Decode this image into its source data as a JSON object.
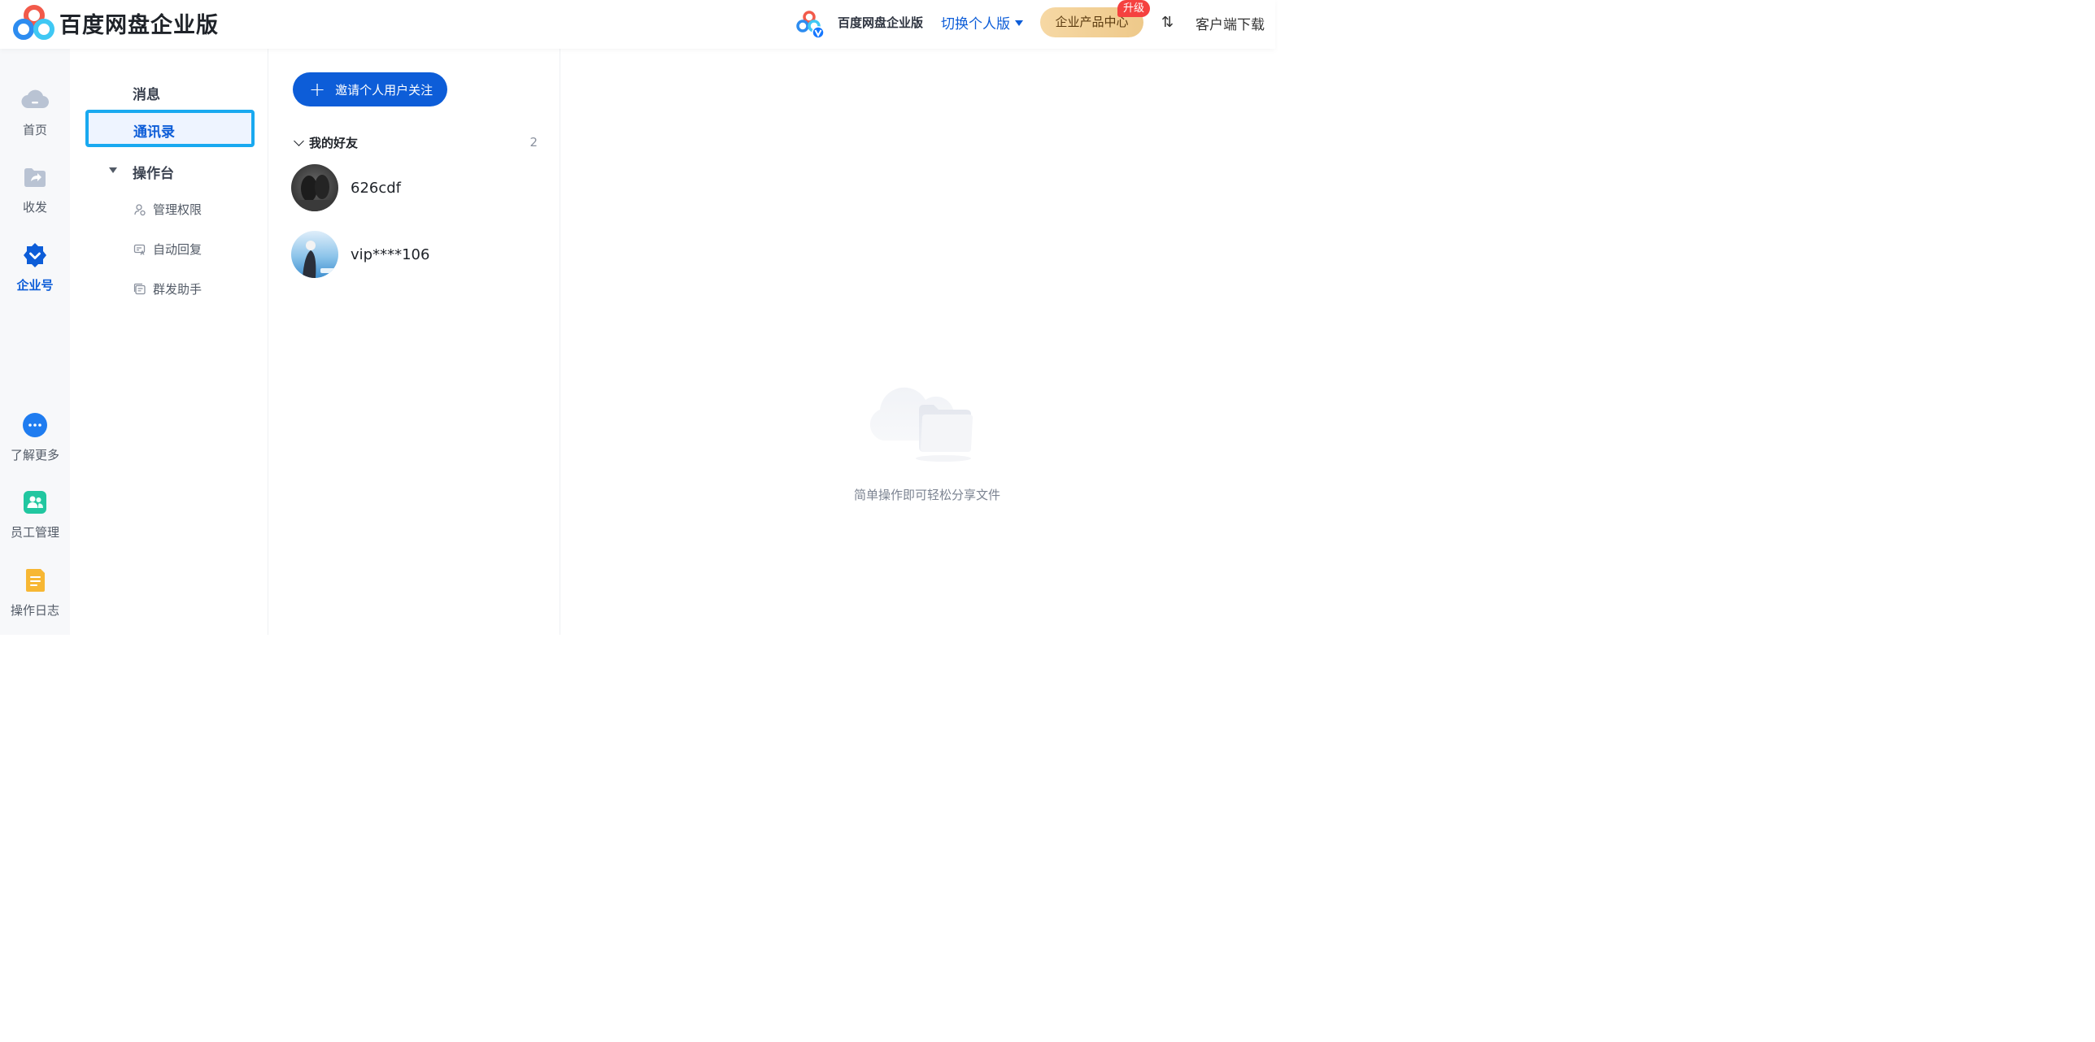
{
  "header": {
    "brand_title": "百度网盘企业版",
    "enterprise_name": "百度网盘企业版",
    "switch_label": "切换个人版",
    "product_center_label": "企业产品中心",
    "upgrade_badge": "升级",
    "transfer_icon": "⇅",
    "client_download_label": "客户端下载"
  },
  "leftnav": {
    "items": [
      {
        "label": "首页",
        "icon": "cloud-home-icon"
      },
      {
        "label": "收发",
        "icon": "share-folder-icon"
      },
      {
        "label": "企业号",
        "icon": "enterprise-badge-icon",
        "active": true
      },
      {
        "label": "了解更多",
        "icon": "more-dots-icon"
      },
      {
        "label": "员工管理",
        "icon": "employees-icon"
      },
      {
        "label": "操作日志",
        "icon": "log-icon"
      }
    ]
  },
  "submenu": {
    "messages": "消息",
    "contacts": "通讯录",
    "workbench": "操作台",
    "sub_items": [
      {
        "label": "管理权限",
        "icon": "user-permission-icon"
      },
      {
        "label": "自动回复",
        "icon": "auto-reply-icon"
      },
      {
        "label": "群发助手",
        "icon": "broadcast-icon"
      }
    ]
  },
  "contacts_panel": {
    "invite_label": "邀请个人用户关注",
    "group_name": "我的好友",
    "group_count": "2",
    "friends": [
      {
        "name": "626cdf"
      },
      {
        "name": "vip****106"
      }
    ]
  },
  "main": {
    "empty_text": "简单操作即可轻松分享文件"
  },
  "colors": {
    "primary": "#0d5dd8",
    "selected_border": "#19a9f0",
    "upgrade_badge": "#f5413f",
    "product_center_gold": "#f6d8a4"
  }
}
